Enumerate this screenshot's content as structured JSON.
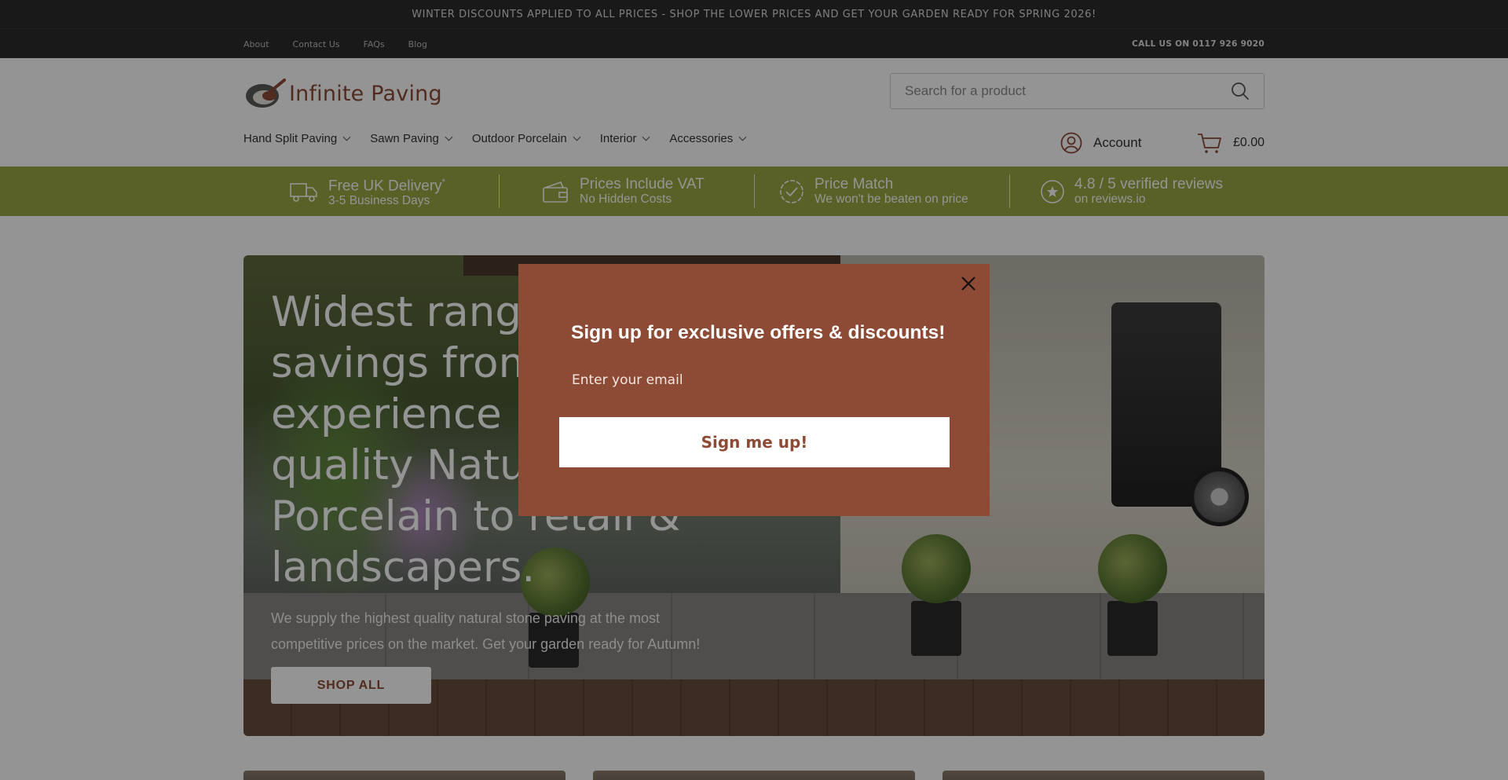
{
  "announcement": "WINTER DISCOUNTS APPLIED TO ALL PRICES - SHOP THE LOWER PRICES AND GET YOUR GARDEN READY FOR SPRING 2026!",
  "utility_links": [
    "About",
    "Contact Us",
    "FAQs",
    "Blog"
  ],
  "call_us": "CALL US ON 0117 926 9020",
  "logo": {
    "text": "Infinite Paving",
    "brand_color": "#8c4b36"
  },
  "search": {
    "placeholder": "Search for a product",
    "icon": "search-icon"
  },
  "nav": [
    {
      "label": "Hand Split Paving"
    },
    {
      "label": "Sawn Paving"
    },
    {
      "label": "Outdoor Porcelain"
    },
    {
      "label": "Interior"
    },
    {
      "label": "Accessories"
    }
  ],
  "account": {
    "label": "Account",
    "icon": "user-circle-icon"
  },
  "cart": {
    "total": "£0.00",
    "icon": "cart-icon"
  },
  "usp": [
    {
      "title": "Free UK Delivery",
      "title_suffix": "*",
      "sub": "3-5 Business Days",
      "icon": "truck-icon"
    },
    {
      "title": "Prices Include VAT",
      "title_suffix": "",
      "sub": "No Hidden Costs",
      "icon": "wallet-icon"
    },
    {
      "title": "Price Match",
      "title_suffix": "",
      "sub": "We won't be beaten on price",
      "icon": "badge-check-icon"
    },
    {
      "title": "4.8 / 5 verified reviews",
      "title_suffix": "",
      "sub": "on reviews.io",
      "icon": "star-circle-icon"
    }
  ],
  "usp_color": "#99a844",
  "hero": {
    "title": "Widest range & savings from experience by quality Natural Stone & Porcelain to retail & landscapers.",
    "title_lines": [
      "Widest range",
      "savings from",
      "experience b",
      "quality Natur",
      "Porcelain to retail &",
      "landscapers."
    ],
    "subtitle": "We supply the highest quality natural stone paving at the most competitive prices on the market. Get your garden ready for Autumn!",
    "subtitle_lines": [
      "We supply the highest quality natural stone paving at the most",
      "competitive prices on the market. Get your garden ready for Autumn!"
    ],
    "button": "SHOP ALL"
  },
  "modal": {
    "title": "Sign up for exclusive offers & discounts!",
    "email_placeholder": "Enter your email",
    "button": "Sign me up!",
    "close_icon": "close-icon",
    "bg_color": "#8d4b36"
  }
}
